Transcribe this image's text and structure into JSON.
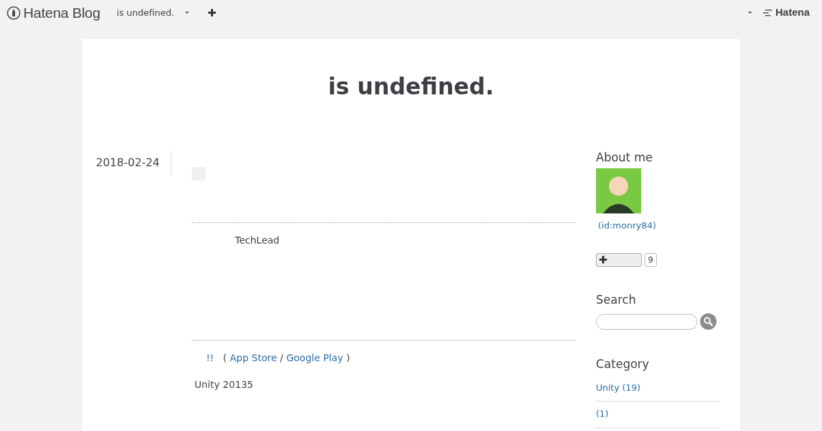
{
  "header": {
    "logo": "Hatena Blog",
    "blog_menu": "is undefined.",
    "brand": "Hatena"
  },
  "blog_title": "is undefined.",
  "entry": {
    "date": "2018-02-24",
    "author_label": "TechLead",
    "links": {
      "lead": "!!",
      "open": "(",
      "items": [
        "App Store",
        "Google Play"
      ],
      "sep": "/",
      "close": ")"
    },
    "body": "Unity 20135"
  },
  "sidebar": {
    "about": {
      "title": "About me",
      "user_id": "(id:monry84)",
      "follow_count": "9"
    },
    "search": {
      "title": "Search"
    },
    "category": {
      "title": "Category",
      "items": [
        "Unity (19)",
        "(1)"
      ]
    }
  }
}
